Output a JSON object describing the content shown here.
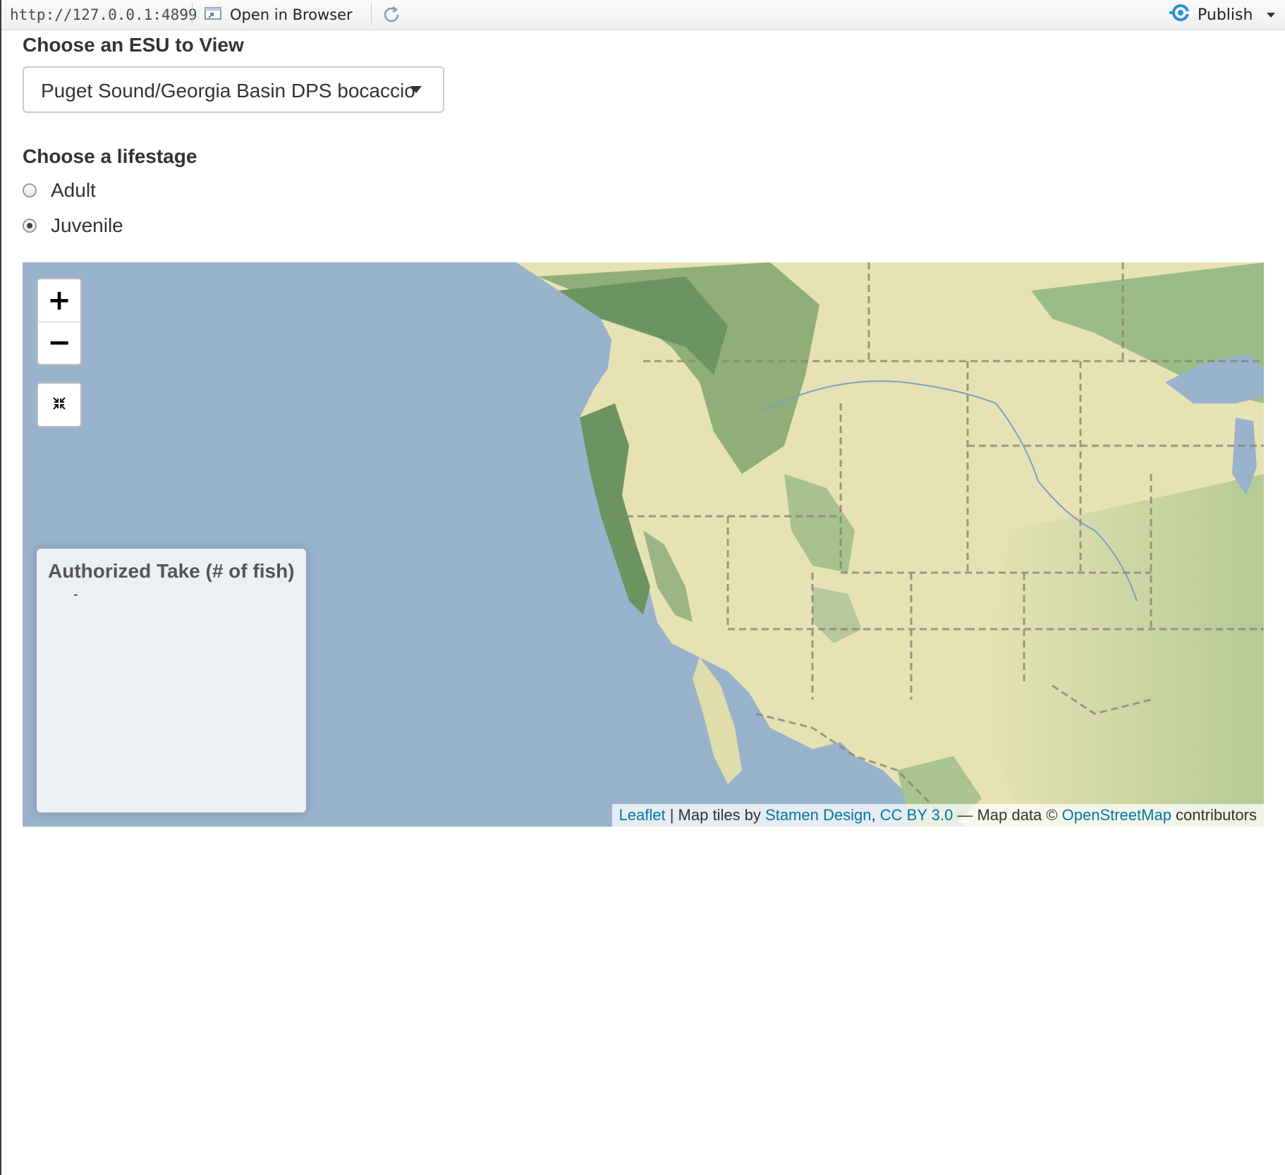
{
  "toolbar": {
    "url": "http://127.0.0.1:4899",
    "open_in_browser": "Open in Browser",
    "publish": "Publish"
  },
  "form": {
    "esu_label": "Choose an ESU to View",
    "esu_selected": "Puget Sound/Georgia Basin DPS bocaccio",
    "lifestage_label": "Choose a lifestage",
    "lifestage_options": [
      "Adult",
      "Juvenile"
    ],
    "lifestage_selected": "Juvenile"
  },
  "map": {
    "zoom_in": "+",
    "zoom_out": "−",
    "legend": {
      "title": "Authorized Take (# of fish)",
      "entry": "-"
    },
    "attribution": {
      "leaflet": "Leaflet",
      "sep1": " | Map tiles by ",
      "stamen": "Stamen Design",
      "comma": ", ",
      "license": "CC BY 3.0",
      "sep2": " — Map data © ",
      "osm": "OpenStreetMap",
      "tail": " contributors"
    },
    "colors": {
      "water": "#99b3cc",
      "land": "#e6e2b4",
      "forest": "#7ea56f",
      "accent": "#0078a8"
    }
  }
}
